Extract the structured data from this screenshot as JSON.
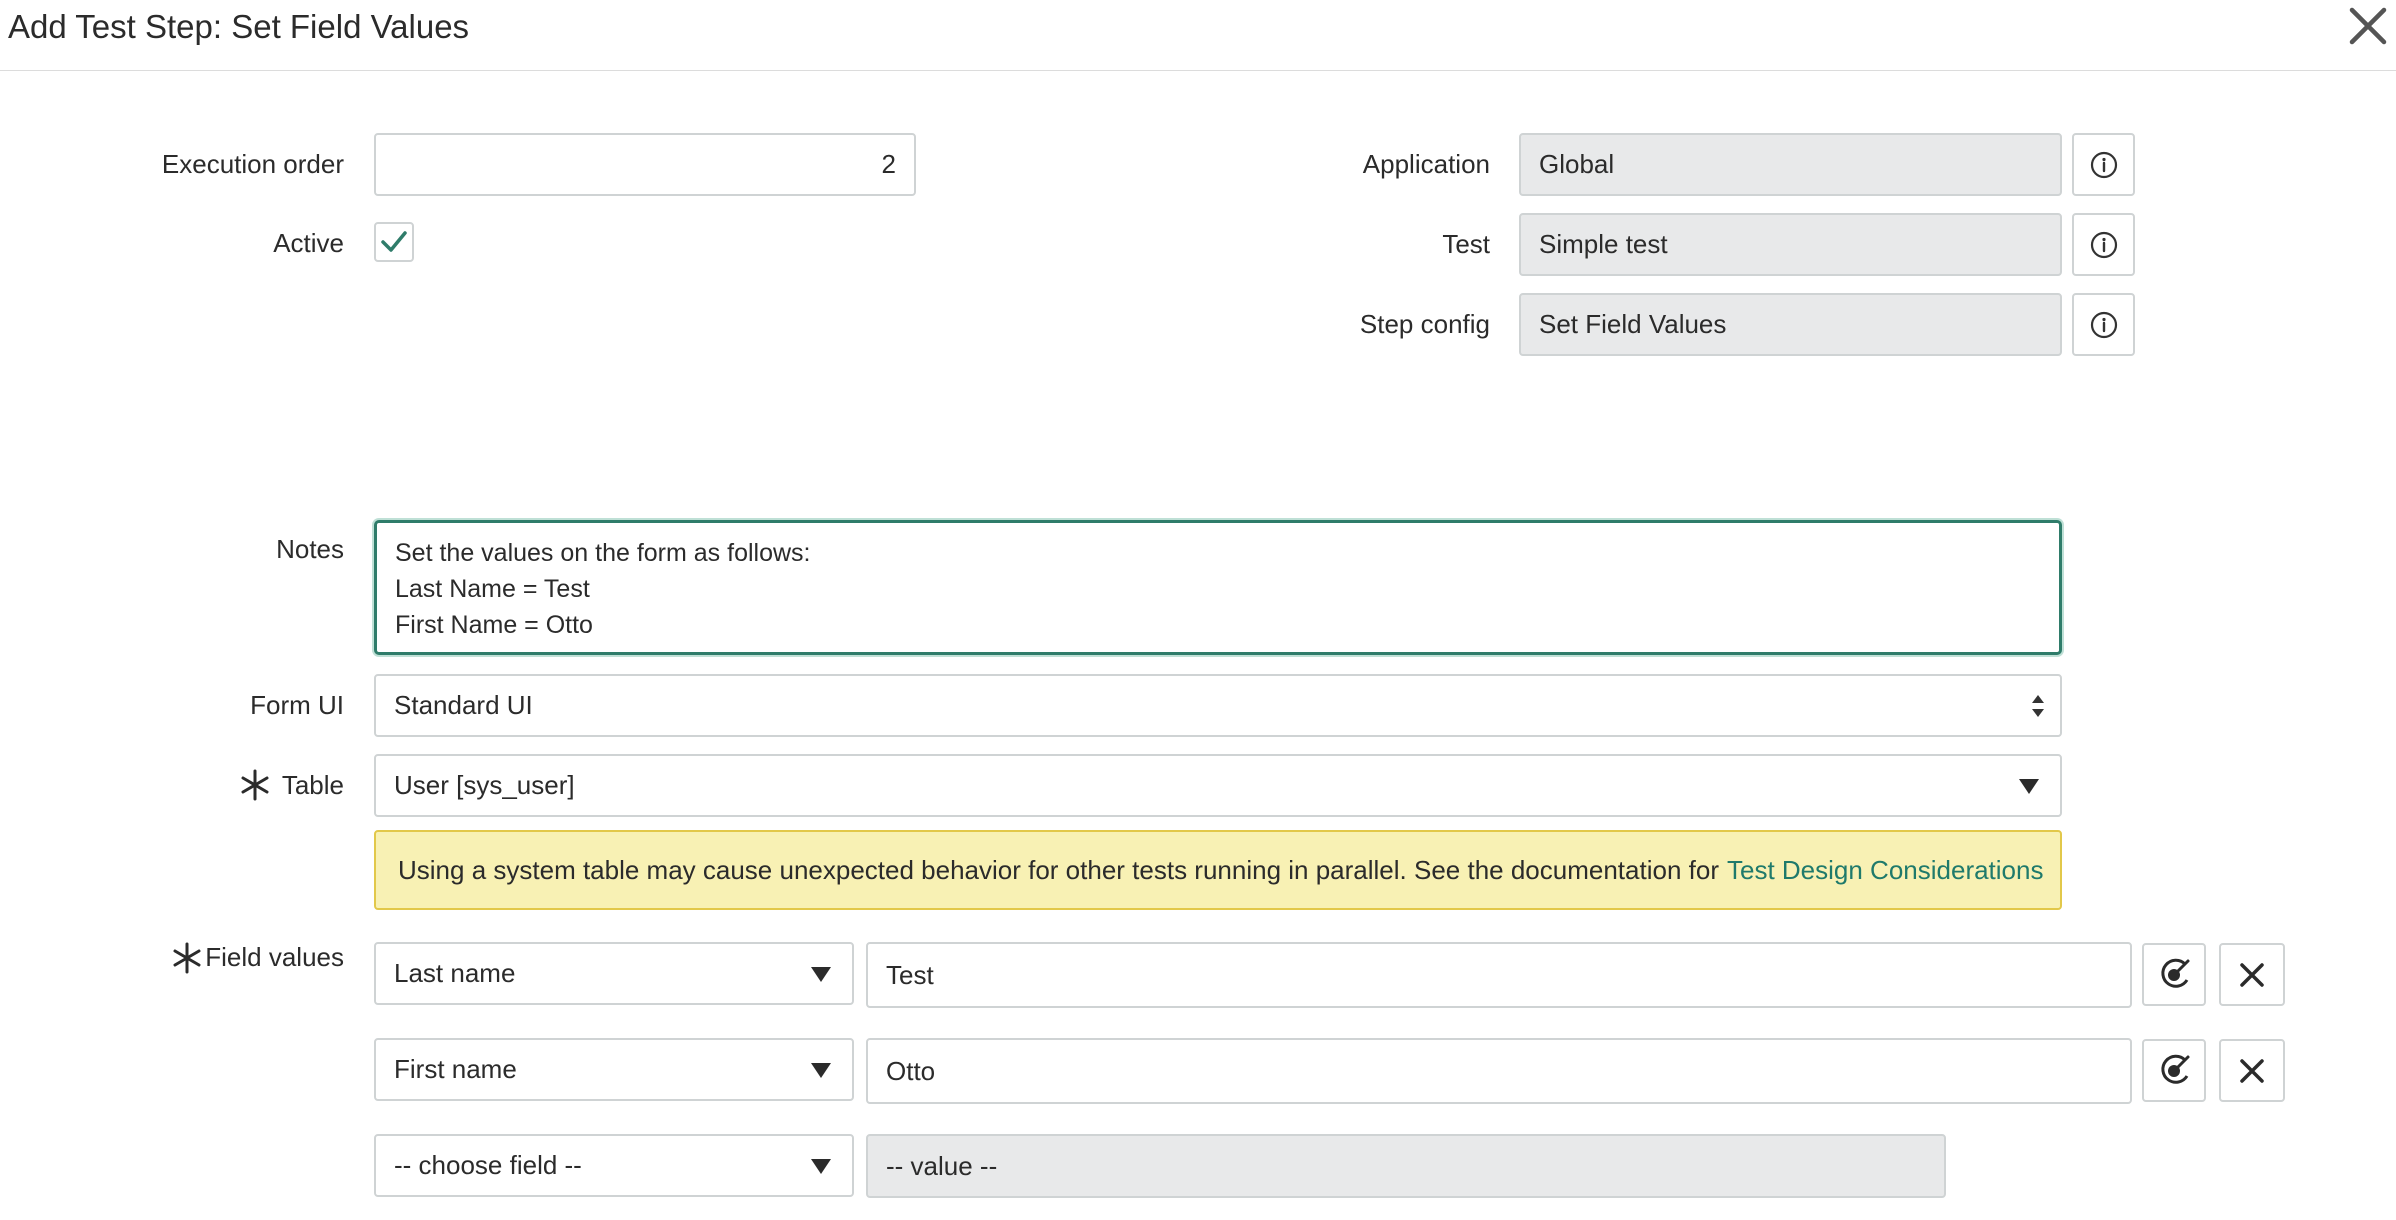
{
  "header": {
    "title": "Add Test Step: Set Field Values",
    "close_icon": "close-icon"
  },
  "form": {
    "execution_order": {
      "label": "Execution order",
      "value": "2"
    },
    "active": {
      "label": "Active",
      "checked": true,
      "icon": "check-icon"
    },
    "application": {
      "label": "Application",
      "value": "Global",
      "info_icon": "info-icon"
    },
    "test": {
      "label": "Test",
      "value": "Simple test",
      "info_icon": "info-icon"
    },
    "step_config": {
      "label": "Step config",
      "value": "Set Field Values",
      "info_icon": "info-icon"
    },
    "notes": {
      "label": "Notes",
      "lines": [
        "Set the values on the form as follows:",
        "Last Name = Test",
        "First Name = Otto"
      ]
    },
    "form_ui": {
      "label": "Form UI",
      "value": "Standard UI"
    },
    "table": {
      "label": "Table",
      "value": "User [sys_user]",
      "required": true
    },
    "warning": {
      "text": "Using a system table may cause unexpected behavior for other tests running in parallel. See the documentation for",
      "link": "Test Design Considerations"
    },
    "field_values": {
      "label": "Field values",
      "required": true,
      "rows": [
        {
          "field": "Last name",
          "value": "Test"
        },
        {
          "field": "First name",
          "value": "Otto"
        }
      ],
      "new_row": {
        "field_placeholder": "-- choose field --",
        "value_placeholder": "-- value --"
      }
    }
  },
  "colors": {
    "accent": "#2f7c6a",
    "link": "#1f7a6b",
    "warning_bg": "#f8f1b4",
    "warning_border": "#e2c84a",
    "readonly_bg": "#e8e9ea"
  }
}
